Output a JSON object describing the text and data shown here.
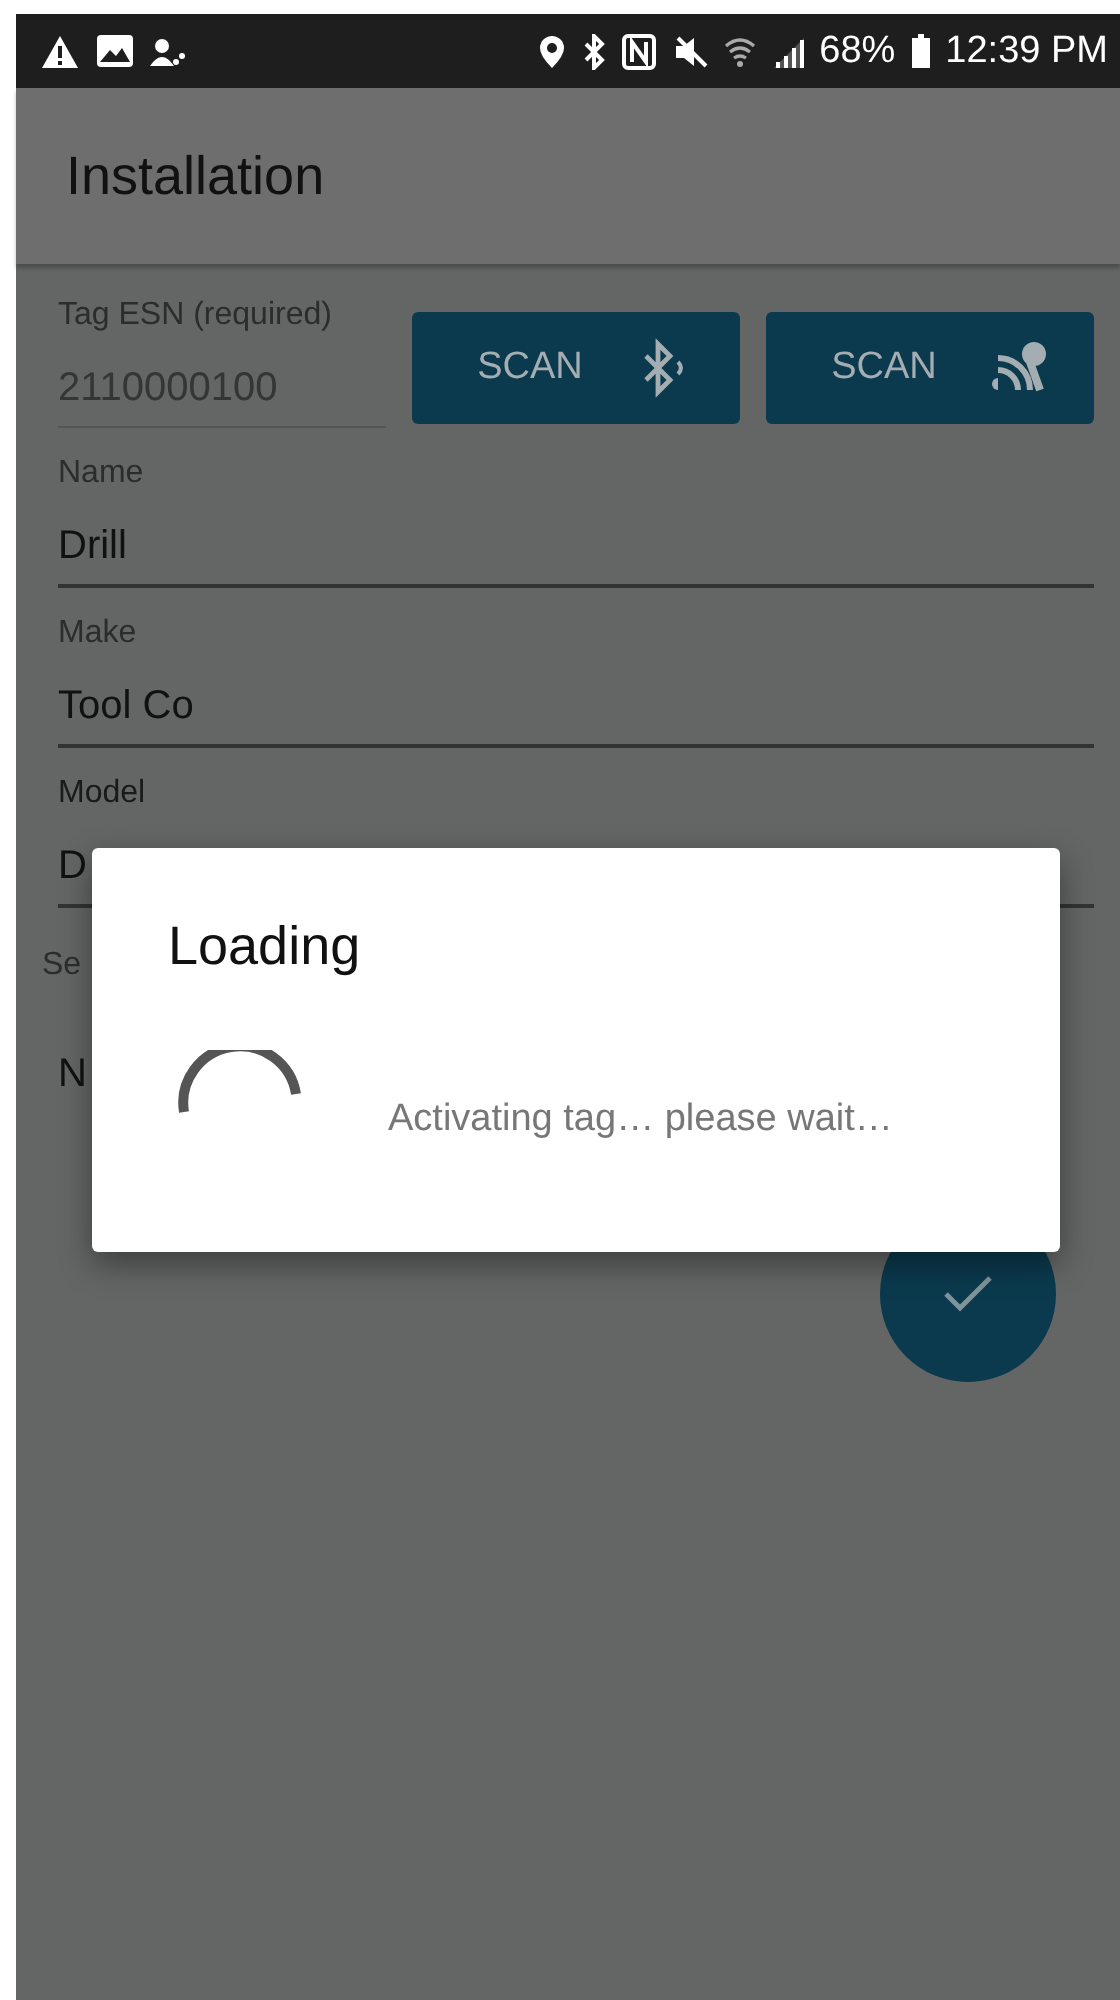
{
  "status_bar": {
    "battery": "68%",
    "time": "12:39 PM"
  },
  "app_bar": {
    "title": "Installation"
  },
  "tag_field": {
    "label": "Tag ESN (required)",
    "value": "2110000100",
    "disabled": true
  },
  "scan_buttons": [
    {
      "label": "SCAN",
      "kind": "bluetooth"
    },
    {
      "label": "SCAN",
      "kind": "nfc"
    }
  ],
  "fields": [
    {
      "label": "Name",
      "value": "Drill",
      "focused": false
    },
    {
      "label": "Make",
      "value": "Tool Co",
      "focused": false
    },
    {
      "label": "Model",
      "value": "D",
      "focused": true
    }
  ],
  "obscured_label": "Se",
  "obscured_value": "N",
  "dialog": {
    "title": "Loading",
    "message": "Activating tag… please wait…"
  }
}
